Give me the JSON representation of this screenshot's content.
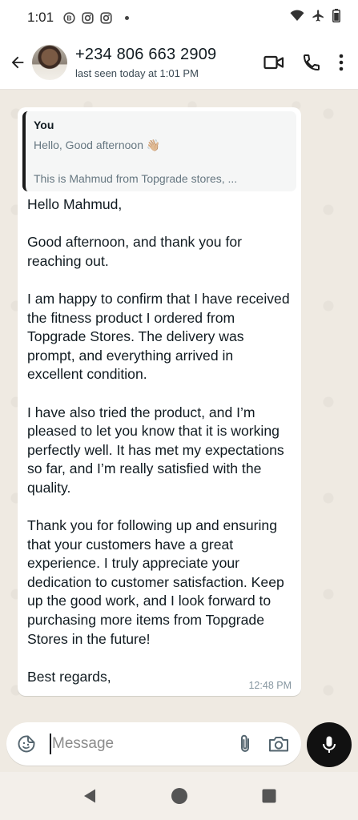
{
  "status_bar": {
    "time": "1:01",
    "icons": [
      "b-circle-icon",
      "instagram-icon",
      "instagram-icon",
      "dot-icon",
      "wifi-icon",
      "airplane-icon",
      "battery-icon"
    ]
  },
  "header": {
    "contact_name": "+234 806 663 2909",
    "last_seen": "last seen today at 1:01 PM",
    "actions": [
      "video-call-icon",
      "voice-call-icon",
      "more-options-icon"
    ]
  },
  "message": {
    "quote": {
      "author": "You",
      "line1": "Hello, Good afternoon 👋🏼",
      "line2": "This is Mahmud from Topgrade stores, ..."
    },
    "paragraphs": [
      "Hello Mahmud,",
      "Good afternoon, and thank you for reaching out.",
      "I am happy to confirm that I have received the fitness product I ordered from Topgrade Stores. The delivery was prompt, and everything arrived in excellent condition.",
      "I have also tried the product, and I’m pleased to let you know that it is working perfectly well. It has met my expectations so far, and I’m really satisfied with the quality.",
      "Thank you for following up and ensuring that your customers have a great experience. I truly appreciate your dedication to customer satisfaction. Keep up the good work, and I look forward to purchasing more items from Topgrade Stores in the future!",
      "Best regards,"
    ],
    "time": "12:48 PM"
  },
  "composer": {
    "placeholder": "Message"
  },
  "colors": {
    "chat_background": "#efeae2",
    "bubble": "#ffffff",
    "mic_button": "#111111"
  }
}
